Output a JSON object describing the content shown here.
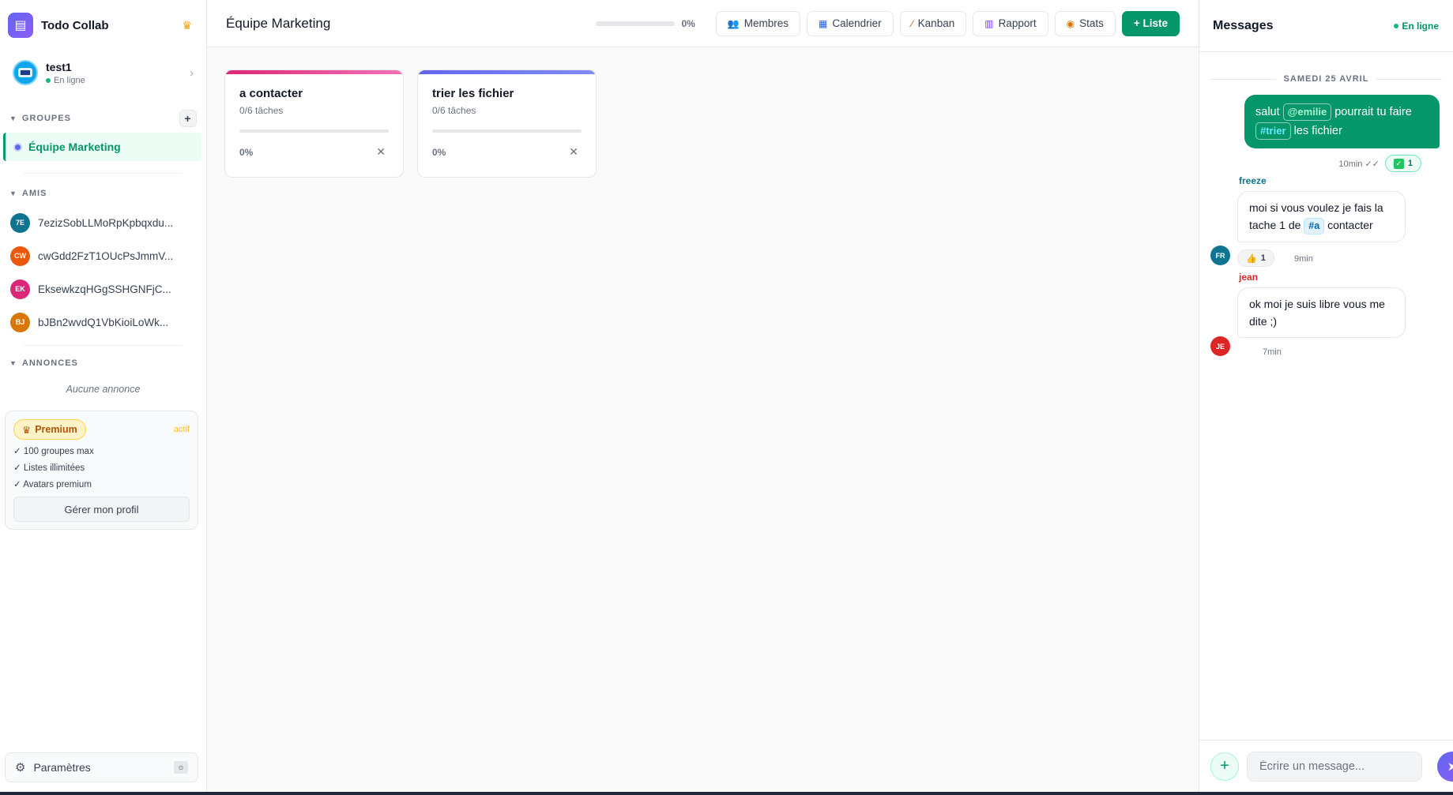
{
  "app": {
    "name": "Todo Collab"
  },
  "user": {
    "name": "test1",
    "status": "En ligne"
  },
  "sidebar": {
    "groups_title": "GROUPES",
    "groups": [
      {
        "label": "Équipe Marketing",
        "active": true
      }
    ],
    "friends_title": "AMIS",
    "friends": [
      {
        "initials": "7E",
        "name": "7ezizSobLLMoRpKpbqxdu...",
        "color": "#0e7490"
      },
      {
        "initials": "CW",
        "name": "cwGdd2FzT1OUcPsJmmV...",
        "color": "#ea580c"
      },
      {
        "initials": "EK",
        "name": "EksewkzqHGgSSHGNFjC...",
        "color": "#db2777"
      },
      {
        "initials": "BJ",
        "name": "bJBn2wvdQ1VbKioiLoWk...",
        "color": "#d97706"
      }
    ],
    "announcements_title": "ANNONCES",
    "announcements_empty": "Aucune annonce",
    "premium": {
      "badge": "Premium",
      "status": "actif",
      "features": [
        "✓ 100 groupes max",
        "✓ Listes illimitées",
        "✓ Avatars premium"
      ],
      "manage_label": "Gérer mon profil"
    },
    "settings_label": "Paramètres",
    "settings_key": "⊙"
  },
  "main": {
    "title": "Équipe Marketing",
    "progress": {
      "value": 0,
      "label": "0%"
    },
    "toolbar": {
      "members": "Membres",
      "calendar": "Calendrier",
      "kanban": "Kanban",
      "report": "Rapport",
      "stats": "Stats",
      "new_list": "+ Liste"
    },
    "lists": [
      {
        "title": "a contacter",
        "count": "0/6 tâches",
        "progress": 0,
        "pct": "0%",
        "stripe": [
          "#db2777",
          "#f472b6"
        ]
      },
      {
        "title": "trier les fichier",
        "count": "0/6 tâches",
        "progress": 0,
        "pct": "0%",
        "stripe": [
          "#6366f1",
          "#818cf8"
        ]
      }
    ]
  },
  "chat": {
    "title": "Messages",
    "status": "En ligne",
    "date_separator": "SAMEDI 25 AVRIL",
    "my_message": {
      "parts": [
        "salut",
        "@emilie",
        "pourrait tu faire",
        "#trier",
        "les fichier"
      ],
      "time": "10min ✓✓",
      "reaction": "1"
    },
    "messages": [
      {
        "sender": "freeze",
        "sender_color": "#0e7490",
        "initials": "FR",
        "avatar_color": "#0e7490",
        "parts": [
          "moi si vous voulez je fais la tache 1 de",
          "#a",
          "contacter"
        ],
        "reaction_emoji": "👍",
        "reaction_count": "1",
        "time": "9min"
      },
      {
        "sender": "jean",
        "sender_color": "#dc2626",
        "initials": "JE",
        "avatar_color": "#dc2626",
        "text": "ok moi je suis libre vous me dite ;)",
        "time": "7min"
      }
    ],
    "composer": {
      "placeholder": "Écrire un message..."
    }
  }
}
